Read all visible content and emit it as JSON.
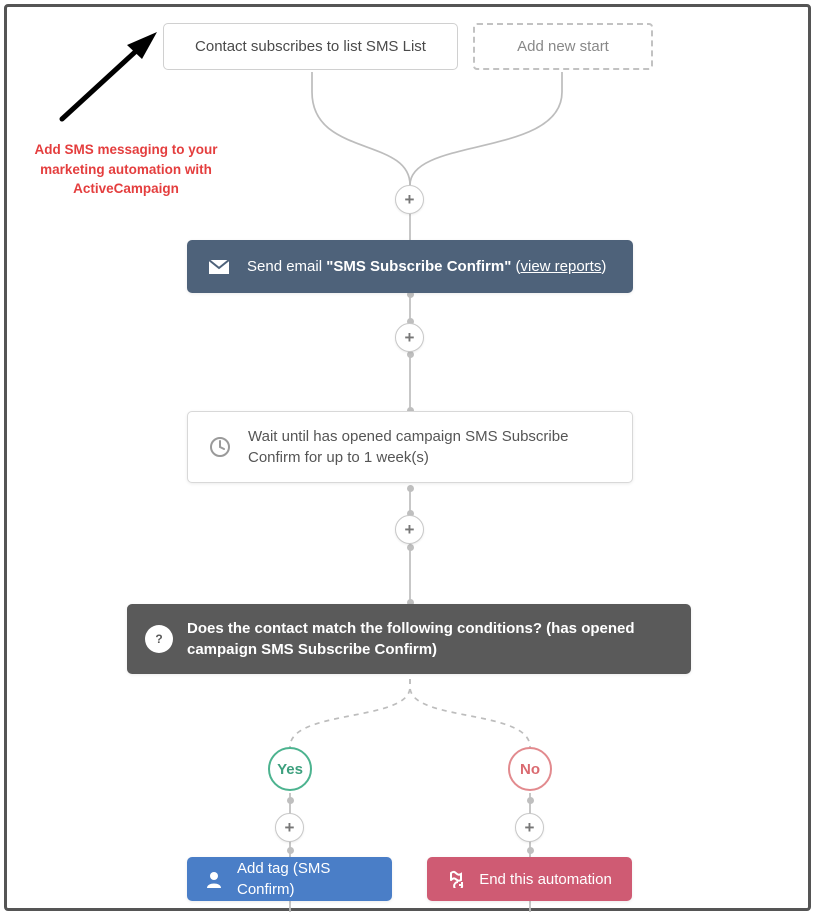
{
  "caption": "Add SMS messaging to your marketing automation with ActiveCampaign",
  "trigger": {
    "label": "Contact subscribes to list SMS List"
  },
  "add_start": {
    "label": "Add new start"
  },
  "plus_glyph": "+",
  "email_step": {
    "prefix": "Send email ",
    "name": "\"SMS Subscribe Confirm\"",
    "suffix": " (",
    "link": "view reports",
    "suffix2": ")"
  },
  "wait_step": {
    "text": "Wait until has opened campaign SMS Subscribe Confirm for up to 1 week(s)"
  },
  "cond_step": {
    "text": "Does the contact match the following conditions? (has opened campaign SMS Subscribe Confirm)"
  },
  "branch": {
    "yes": "Yes",
    "no": "No"
  },
  "tag_step": {
    "prefix": "Add tag ",
    "value": "(SMS Confirm)"
  },
  "end_step": {
    "label": "End this automation"
  }
}
